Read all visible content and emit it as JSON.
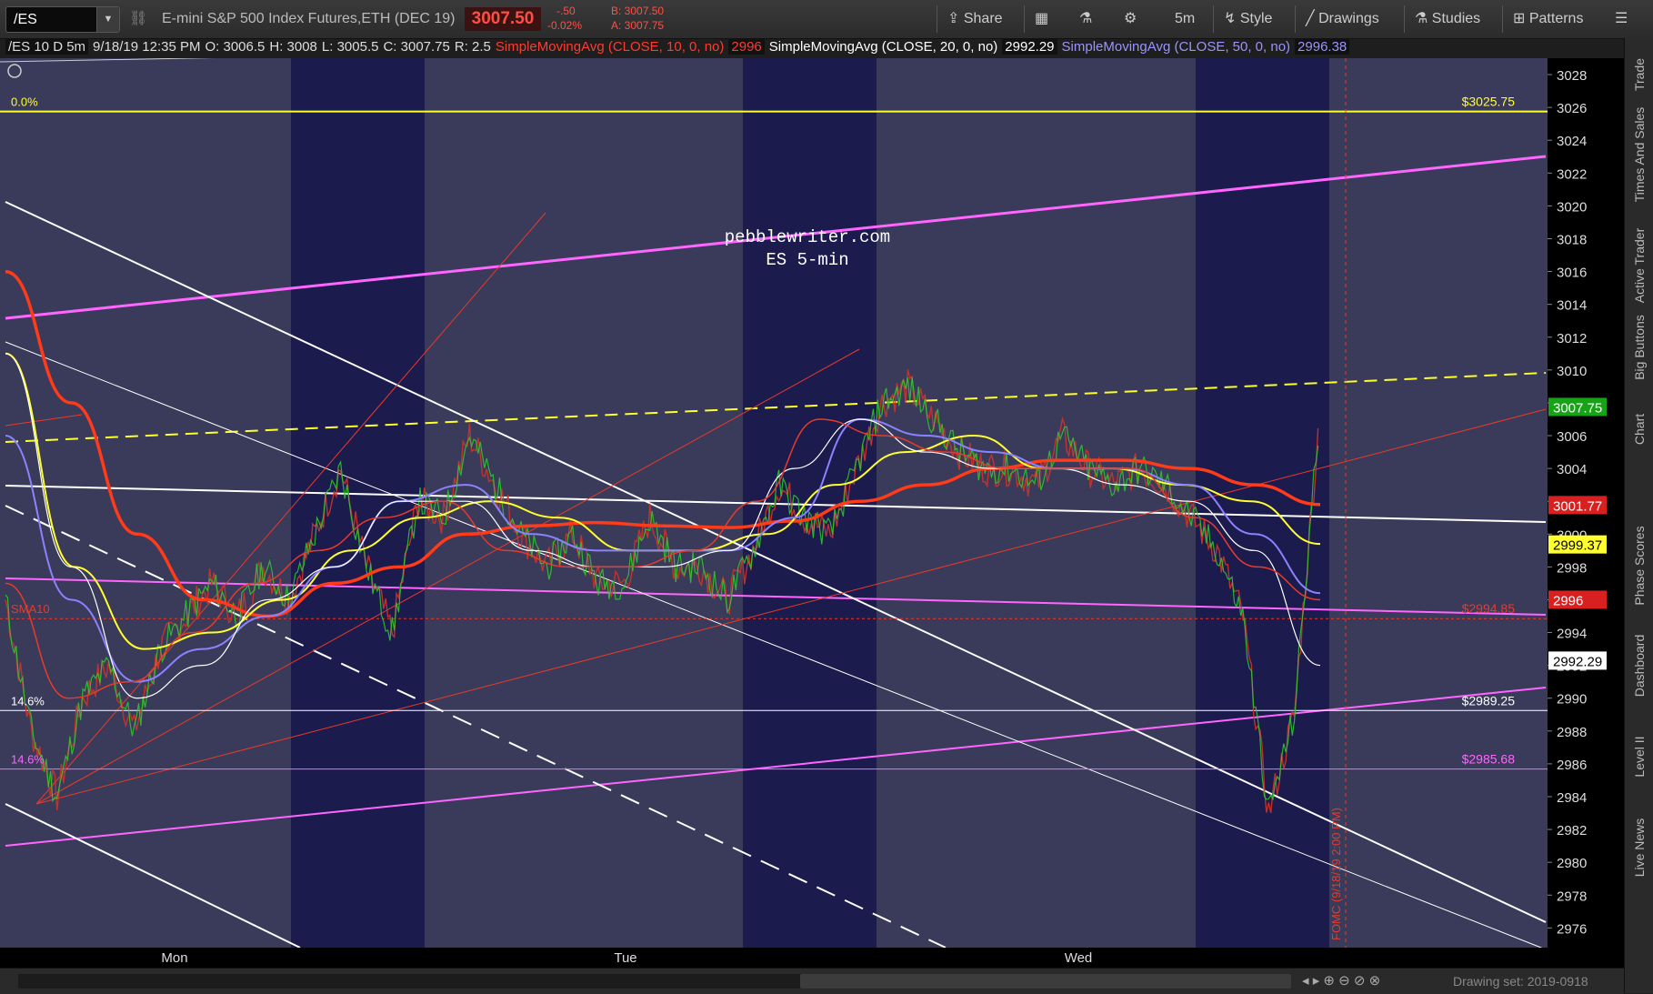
{
  "toolbar": {
    "symbol": "/ES",
    "description": "E-mini S&P 500 Index Futures,ETH (DEC 19)",
    "last": "3007.50",
    "change": "-.50",
    "change_pct": "-0.02%",
    "bid": "B: 3007.50",
    "ask": "A: 3007.75",
    "share": "Share",
    "interval": "5m",
    "style": "Style",
    "drawings": "Drawings",
    "studies": "Studies",
    "patterns": "Patterns"
  },
  "info": {
    "label": "/ES 10 D 5m",
    "datetime": "9/18/19 12:35 PM",
    "open": "O: 3006.5",
    "high": "H: 3008",
    "low": "L: 3005.5",
    "close": "C: 3007.75",
    "range": "R: 2.5",
    "sma10_label": "SimpleMovingAvg (CLOSE, 10, 0, no)",
    "sma10_value": "2996",
    "sma20_label": "SimpleMovingAvg (CLOSE, 20, 0, no)",
    "sma20_value": "2992.29",
    "sma50_label": "SimpleMovingAvg (CLOSE, 50, 0, no)",
    "sma50_value": "2996.38"
  },
  "colors": {
    "background": "#3a3a5a",
    "session_band": "#1b1b4d",
    "sma10": "#e83a2a",
    "sma20": "#ffffff",
    "sma50": "#8a82ff",
    "sma_yellow": "#ffff2e",
    "channel": "#ff66ff",
    "fib": "#ffff2e"
  },
  "chart_data": {
    "type": "line",
    "title": "pebblewriter.com",
    "subtitle": "ES 5-min",
    "x_labels": [
      "Mon",
      "Tue",
      "Wed"
    ],
    "y_ticks": [
      2976,
      2978,
      2980,
      2982,
      2984,
      2986,
      2988,
      2990,
      2992,
      2994,
      2996,
      2998,
      3000,
      3002,
      3004,
      3006,
      3008,
      3010,
      3012,
      3014,
      3016,
      3018,
      3020,
      3022,
      3024,
      3026,
      3028
    ],
    "ylim": [
      2974.8,
      3029
    ],
    "price_path": [
      2996,
      2988,
      2984,
      2990,
      2992,
      2988,
      2993,
      2995,
      2997,
      2995,
      2998,
      2996,
      3000,
      3004,
      2998,
      2994,
      3002,
      3001,
      3006,
      3003,
      3000,
      2998,
      3000,
      2997,
      2997,
      3001,
      2998,
      2998,
      2996,
      2999,
      3003,
      3001,
      3000,
      3004,
      3008,
      3009,
      3007,
      3005,
      3004,
      3004,
      3003,
      3006,
      3004,
      3003,
      3004,
      3003,
      3001,
      2999,
      2995,
      2983,
      2989,
      3007.75
    ],
    "sma10_path": [
      2997,
      2990,
      2991,
      2994,
      2997,
      2999,
      3001,
      3002,
      2999,
      2998,
      2998,
      2999,
      3002,
      3007,
      3006,
      3005,
      3004,
      3004,
      3004,
      3001,
      2998,
      2996
    ],
    "sma20_path": [
      3011,
      2998,
      2990,
      2992,
      2996,
      2998,
      3002,
      3002,
      2999,
      2998,
      2998,
      2999,
      3004,
      3007,
      3005,
      3004,
      3004,
      3003,
      3002,
      2999,
      2992
    ],
    "sma50_path": [
      3006,
      2996,
      2991,
      2993,
      2995,
      2998,
      3002,
      3003,
      3000,
      2999,
      2999,
      2999,
      3001,
      3007,
      3006,
      3005,
      3004,
      3004,
      3003,
      3000,
      2996.4
    ],
    "sma_yellow_path": [
      3011,
      2998,
      2993,
      2994,
      2996,
      2999,
      3001,
      3002,
      3001,
      2999,
      2999,
      3000,
      3003,
      3005,
      3006,
      3004,
      3004,
      3003,
      3002,
      2999.4
    ],
    "sma_red_path": [
      3016,
      3008,
      3000,
      2996,
      2995,
      2997,
      2998,
      3000,
      3000.5,
      3000.7,
      3000.5,
      3000.4,
      3000.8,
      3002,
      3003,
      3004,
      3004.5,
      3004.5,
      3004,
      3003,
      3001.8
    ],
    "horizontal_levels": [
      {
        "label": "0.0%",
        "value": 3025.75,
        "text": "$3025.75",
        "color": "#ffff2e"
      },
      {
        "label": "14.6%",
        "value": 2989.25,
        "text": "$2989.25",
        "color": "#ffffff"
      },
      {
        "label": "14.6%",
        "value": 2985.68,
        "text": "$2985.68",
        "color": "#ff66ff"
      },
      {
        "label": "SMA10",
        "value": 2994.85,
        "text": "$2994.85",
        "color": "#e83a2a"
      }
    ],
    "price_tags": [
      {
        "value": 3007.75,
        "text": "3007.75",
        "bg": "#16a316",
        "fg": "#ffffff"
      },
      {
        "value": 3001.77,
        "text": "3001.77",
        "bg": "#d82020",
        "fg": "#ffffff"
      },
      {
        "value": 2999.37,
        "text": "2999.37",
        "bg": "#ffff2e",
        "fg": "#000000"
      },
      {
        "value": 2996,
        "text": "2996",
        "bg": "#d82020",
        "fg": "#ffffff"
      },
      {
        "value": 2992.29,
        "text": "2992.29",
        "bg": "#ffffff",
        "fg": "#000000"
      }
    ],
    "event_label": "FOMC (9/18/19 2:00 PM)"
  },
  "side_tabs": [
    "Trade",
    "Times And Sales",
    "Active Trader",
    "Big Buttons",
    "Chart",
    "Phase Scores",
    "Dashboard",
    "Level II",
    "Live News"
  ],
  "bottom": {
    "drawing_set": "Drawing set: 2019-0918"
  }
}
